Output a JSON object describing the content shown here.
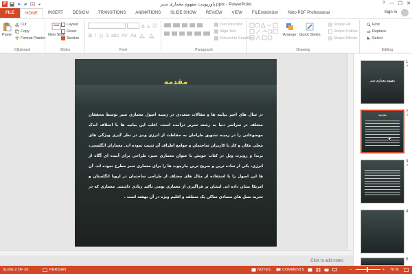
{
  "window": {
    "title": "پاورپوینت مفهوم معماری سبز.pptx - PowerPoint",
    "minimize": "—",
    "restore": "❐",
    "close": "✕",
    "help": "?"
  },
  "tabs": [
    {
      "label": "FILE"
    },
    {
      "label": "HOME"
    },
    {
      "label": "INSERT"
    },
    {
      "label": "DESIGN"
    },
    {
      "label": "TRANSITIONS"
    },
    {
      "label": "ANIMATIONS"
    },
    {
      "label": "SLIDE SHOW"
    },
    {
      "label": "REVIEW"
    },
    {
      "label": "VIEW"
    },
    {
      "label": "FILEminimizer"
    },
    {
      "label": "Nitro PDF Professional"
    }
  ],
  "account": {
    "signin": "Sign in"
  },
  "ribbon": {
    "clipboard": {
      "paste": "Paste",
      "cut": "Cut",
      "copy": "Copy",
      "format_painter": "Format Painter",
      "label": "Clipboard"
    },
    "slides": {
      "new_slide": "New Slide",
      "layout": "Layout",
      "reset": "Reset",
      "section": "Section",
      "label": "Slides"
    },
    "font": {
      "label": "Font"
    },
    "paragraph": {
      "text_direction": "Text Direction",
      "align_text": "Align Text",
      "convert_smartart": "Convert to SmartArt",
      "label": "Paragraph"
    },
    "drawing": {
      "arrange": "Arrange",
      "quick_styles": "Quick Styles",
      "shape_fill": "Shape Fill",
      "shape_outline": "Shape Outline",
      "shape_effects": "Shape Effects",
      "label": "Drawing"
    },
    "editing": {
      "find": "Find",
      "replace": "Replace",
      "select": "Select",
      "label": "Editing"
    }
  },
  "slide": {
    "title": "مقدمه",
    "body": "در سال های اخیر بیانیه ها و مقالات متعددی در زمینه اصول معماری سبز توسط محققان مختلف در سراسر دنیا به رشته تحریر درآمده است. اغلب این بیانیه ها با اختلاف اندک موضوعاتی را در زمینه تشویق طراحان به حفاظت از انرژی ونیز در نظر گیری ویژگی های محلی مکان و کار با کاربران ساختمان و جوامع اطراف آن تثبیت نموده اند. معماران انگلیسی، برندا و روبرت ویل در کتاب خویش با عنوان معماری سبز: طراحی برای آینده ای آگاه از انرژی، یکی از ساده ترین و صریح ترین چارچوب ها را برای معماری سبز مطرح نموده اند. آن ها این اصول را با استفاده از مثال های مختلف از طراحی ساختمان در اروپا انگلستان و امریکا نشان داده اند. ایشان بر فراگیری از معماری بومی تأکید زیادی داشتند. معماری که در تجربه نسل های متمادی ساکن یک منطقه و اقلیم ویژه در آن نهفته است ."
  },
  "notes_hint": "Click to add notes",
  "thumbnails": [
    {
      "num": "1",
      "star": "*",
      "title": "مفهوم معماری سبز"
    },
    {
      "num": "2",
      "star": "*",
      "title": "مقدمه"
    },
    {
      "num": "3",
      "star": "*",
      "title": ""
    },
    {
      "num": "4",
      "star": "",
      "title": ""
    },
    {
      "num": "5",
      "star": "",
      "title": ""
    }
  ],
  "status": {
    "slide_of": "SLIDE 2 OF 26",
    "language": "PERSIAN",
    "notes": "NOTES",
    "comments": "COMMENTS",
    "zoom": "70 %",
    "zoom_minus": "−",
    "zoom_plus": "+"
  },
  "colors": {
    "accent": "#d24726",
    "title_yellow": "#f5d838"
  }
}
